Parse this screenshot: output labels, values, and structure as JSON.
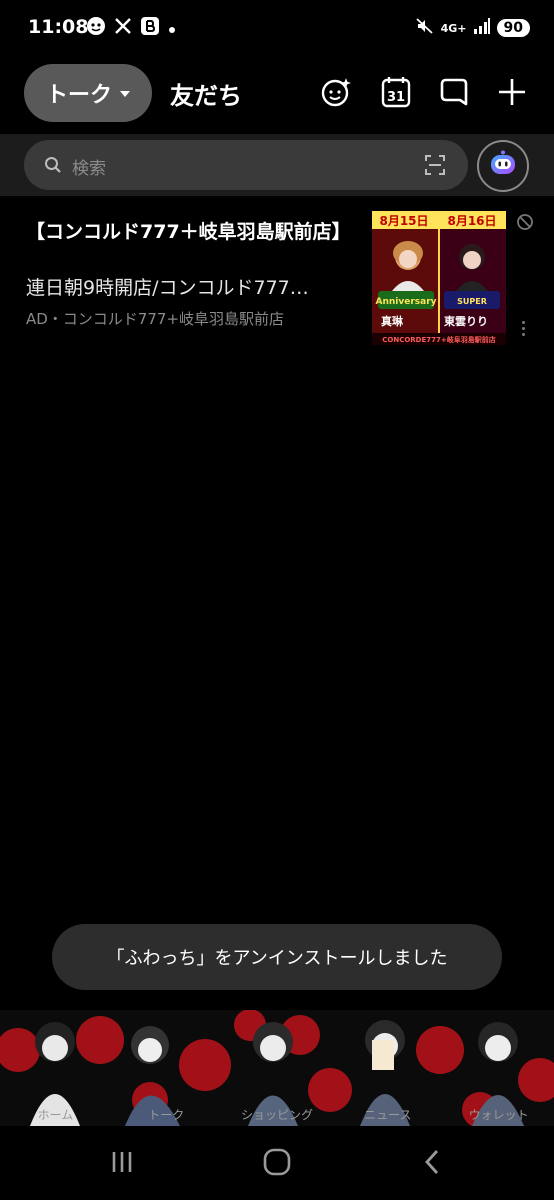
{
  "status_bar": {
    "time": "11:08",
    "left_icons": [
      "notification-app-icon",
      "x-icon",
      "bereal-icon",
      "dot-icon"
    ],
    "network": "4G+",
    "battery": "90",
    "mute_icon": "mute-icon",
    "signal_icon": "signal-icon"
  },
  "header": {
    "talk_tab": "トーク",
    "friends_tab": "友だち",
    "icons": [
      "sparkle-face-icon",
      "calendar-icon",
      "chat-bubble-icon",
      "plus-icon"
    ],
    "calendar_day": "31"
  },
  "search": {
    "placeholder": "検索"
  },
  "ad": {
    "title": "【コンコルド777＋岐阜羽島駅前店】",
    "description": "連日朝9時開店/コンコルド777…",
    "meta": "AD・コンコルド777+岐阜羽島駅前店",
    "image": {
      "date_left": "8月15日",
      "date_right": "8月16日",
      "name_left": "真琳",
      "name_right": "東雲りり",
      "brand": "CONCORDE777+岐阜羽島駅前店"
    }
  },
  "toast": {
    "message": "「ふわっち」をアンインストールしました"
  },
  "tabbar": {
    "labels": [
      "ホーム",
      "トーク",
      "ショッピング",
      "ニュース",
      "ウォレット"
    ]
  },
  "colors": {
    "background": "#000000",
    "search_bg": "#3a3a3a",
    "tab_active_bg": "#595959",
    "toast_bg": "#2d2d2d",
    "banner_red": "#c4141a"
  }
}
